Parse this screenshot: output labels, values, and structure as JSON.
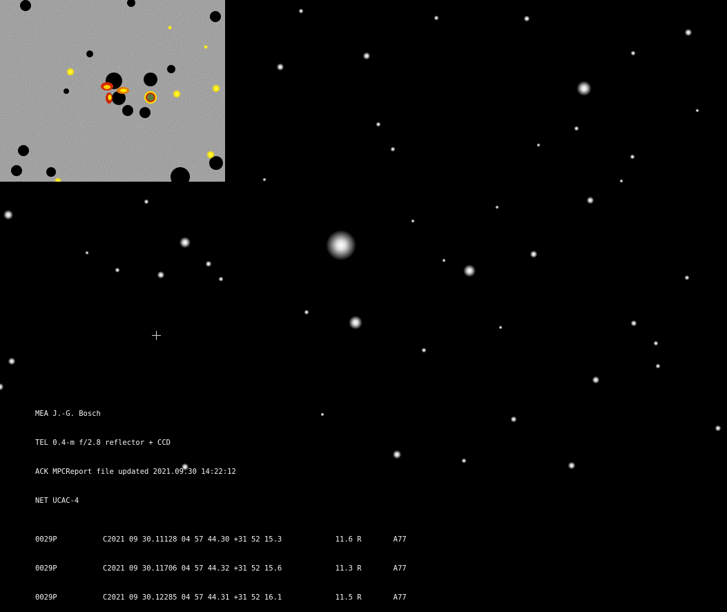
{
  "image": {
    "kind": "astronomical CCD frame with processed inset",
    "background": "#000000",
    "inset_palette": [
      "#6e6e6e",
      "#bdbdbd",
      "#ffe600",
      "#d42a00"
    ]
  },
  "report": {
    "header_lines": [
      "MEA J.-G. Bosch",
      "TEL 0.4-m f/2.8 reflector + CCD",
      "ACK MPCReport file updated 2021.09.30 14:22:12",
      "NET UCAC-4"
    ],
    "observations": [
      {
        "object": "0029P",
        "date": "C2021 09 30.11128",
        "ra": "04 57 44.30",
        "dec": "+31 52 15.3",
        "mag": "11.6 R",
        "code": "A77"
      },
      {
        "object": "0029P",
        "date": "C2021 09 30.11706",
        "ra": "04 57 44.32",
        "dec": "+31 52 15.6",
        "mag": "11.3 R",
        "code": "A77"
      },
      {
        "object": "0029P",
        "date": "C2021 09 30.12285",
        "ra": "04 57 44.31",
        "dec": "+31 52 16.1",
        "mag": "11.5 R",
        "code": "A77"
      }
    ]
  }
}
